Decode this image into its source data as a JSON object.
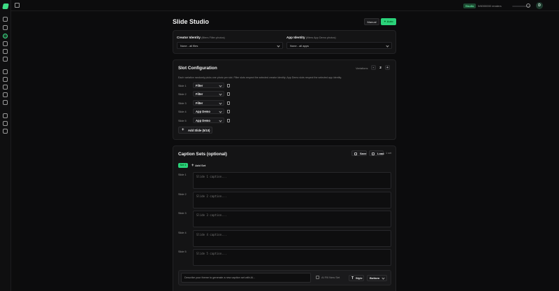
{
  "topbar": {
    "badge": "Studio",
    "quota_text": "0/6000000 renders",
    "quota_progress": 0.0,
    "avatar_initial": "D"
  },
  "page": {
    "title": "Slide Studio",
    "manual_label": "Manual",
    "auto_label": "Auto"
  },
  "identity": {
    "creator_label": "Creator Identity",
    "creator_sub": "(filters Filter photos)",
    "creator_value": "None - all files",
    "app_label": "App Identity",
    "app_sub": "(filters App Demo photos)",
    "app_value": "None - all apps"
  },
  "slots": {
    "title": "Slot Configuration",
    "variations_label": "Variations",
    "variations_value": "2",
    "minus": "-",
    "plus": "+",
    "description": "Each variation randomly picks one photo per slot. Filter slots respect the selected creator identity; App Demo slots respect the selected app identity.",
    "items": [
      {
        "label": "Slide 1",
        "value": "Filter"
      },
      {
        "label": "Slide 2",
        "value": "Filter"
      },
      {
        "label": "Slide 3",
        "value": "Filter"
      },
      {
        "label": "Slide 4",
        "value": "App Demo"
      },
      {
        "label": "Slide 5",
        "value": "App Demo"
      }
    ],
    "add_label": "Add Slide (5/10)"
  },
  "captions": {
    "title": "Caption Sets (optional)",
    "save_label": "Save",
    "load_label": "Load",
    "count_text": "1 set",
    "active_tab": "Set 1",
    "add_set_label": "Add Set",
    "items": [
      {
        "label": "Slide 1",
        "placeholder": "Slide 1 caption..."
      },
      {
        "label": "Slide 2",
        "placeholder": "Slide 2 caption..."
      },
      {
        "label": "Slide 3",
        "placeholder": "Slide 3 caption..."
      },
      {
        "label": "Slide 4",
        "placeholder": "Slide 4 caption..."
      },
      {
        "label": "Slide 5",
        "placeholder": "Slide 5 caption..."
      }
    ],
    "ai_placeholder": "Describe your theme to generate a new caption set with AI...",
    "ai_fill_label": "AI Fill New Set",
    "style_label": "Style",
    "position_value": "Bottom"
  }
}
